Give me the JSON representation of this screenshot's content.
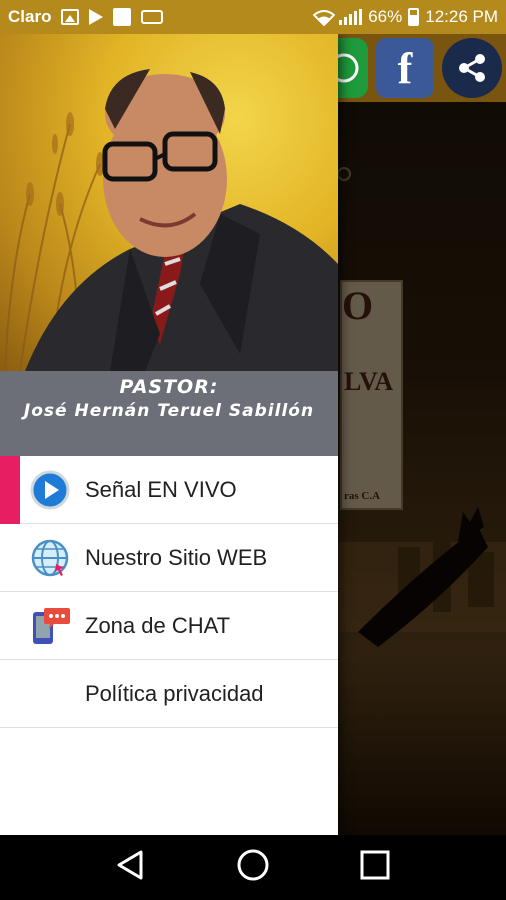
{
  "status_bar": {
    "carrier": "Claro",
    "battery": "66%",
    "time": "12:26 PM",
    "icons": [
      "image-icon",
      "play-icon",
      "square-icon",
      "voicemail-icon",
      "wifi-icon",
      "signal-icon",
      "battery-icon"
    ]
  },
  "share_bar": {
    "buttons": [
      "whatsapp-icon",
      "facebook-icon",
      "share-icon"
    ],
    "facebook_glyph": "f"
  },
  "background": {
    "card_text_1": "O",
    "card_text_2": "LVA",
    "card_text_3": "ras C.A"
  },
  "drawer": {
    "caption_title": "PASTOR:",
    "caption_name": "José Hernán Teruel Sabillón",
    "menu": [
      {
        "label": "Señal EN VIVO",
        "icon": "play-circle-icon",
        "active": true
      },
      {
        "label": "Nuestro Sitio WEB",
        "icon": "globe-icon",
        "active": false
      },
      {
        "label": "Zona de CHAT",
        "icon": "chat-phone-icon",
        "active": false
      },
      {
        "label": "Política privacidad",
        "icon": "",
        "active": false
      }
    ]
  },
  "colors": {
    "status_bar": "#b58a1c",
    "accent": "#e81e63",
    "caption_bg": "#6d6f78"
  },
  "nav_bar": {
    "buttons": [
      "back-icon",
      "home-icon",
      "recents-icon"
    ]
  }
}
